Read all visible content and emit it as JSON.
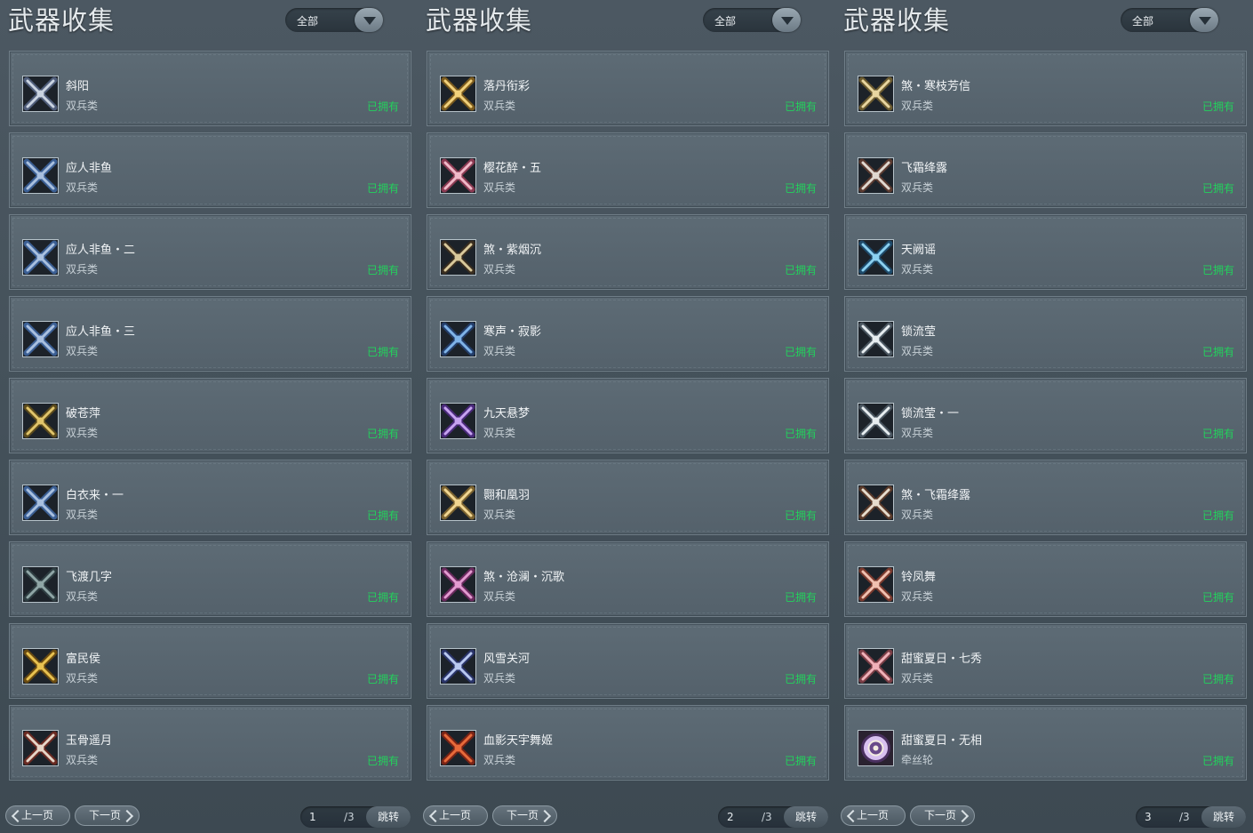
{
  "panels": [
    {
      "title": "武器收集",
      "filter_label": "全部",
      "prev_label": "上一页",
      "next_label": "下一页",
      "page_value": "1",
      "page_total": "/3",
      "jump_label": "跳转",
      "items": [
        {
          "name": "斜阳",
          "type": "双兵类",
          "status": "已拥有"
        },
        {
          "name": "应人非鱼",
          "type": "双兵类",
          "status": "已拥有"
        },
        {
          "name": "应人非鱼・二",
          "type": "双兵类",
          "status": "已拥有"
        },
        {
          "name": "应人非鱼・三",
          "type": "双兵类",
          "status": "已拥有"
        },
        {
          "name": "破苍萍",
          "type": "双兵类",
          "status": "已拥有"
        },
        {
          "name": "白衣来・一",
          "type": "双兵类",
          "status": "已拥有"
        },
        {
          "name": "飞渡几字",
          "type": "双兵类",
          "status": "已拥有"
        },
        {
          "name": "富民侯",
          "type": "双兵类",
          "status": "已拥有"
        },
        {
          "name": "玉骨遥月",
          "type": "双兵类",
          "status": "已拥有"
        }
      ]
    },
    {
      "title": "武器收集",
      "filter_label": "全部",
      "prev_label": "上一页",
      "next_label": "下一页",
      "page_value": "2",
      "page_total": "/3",
      "jump_label": "跳转",
      "items": [
        {
          "name": "落丹衔彩",
          "type": "双兵类",
          "status": "已拥有"
        },
        {
          "name": "樱花醉・五",
          "type": "双兵类",
          "status": "已拥有"
        },
        {
          "name": "煞・紫烟沉",
          "type": "双兵类",
          "status": "已拥有"
        },
        {
          "name": "寒声・寂影",
          "type": "双兵类",
          "status": "已拥有"
        },
        {
          "name": "九天悬梦",
          "type": "双兵类",
          "status": "已拥有"
        },
        {
          "name": "翾和凰羽",
          "type": "双兵类",
          "status": "已拥有"
        },
        {
          "name": "煞・沧澜・沉歌",
          "type": "双兵类",
          "status": "已拥有"
        },
        {
          "name": "风雪关河",
          "type": "双兵类",
          "status": "已拥有"
        },
        {
          "name": "血影天宇舞姬",
          "type": "双兵类",
          "status": "已拥有"
        }
      ]
    },
    {
      "title": "武器收集",
      "filter_label": "全部",
      "prev_label": "上一页",
      "next_label": "下一页",
      "page_value": "3",
      "page_total": "/3",
      "jump_label": "跳转",
      "items": [
        {
          "name": "煞・寒枝芳信",
          "type": "双兵类",
          "status": "已拥有"
        },
        {
          "name": "飞霜绛露",
          "type": "双兵类",
          "status": "已拥有"
        },
        {
          "name": "天阙谣",
          "type": "双兵类",
          "status": "已拥有"
        },
        {
          "name": "锁流莹",
          "type": "双兵类",
          "status": "已拥有"
        },
        {
          "name": "锁流莹・一",
          "type": "双兵类",
          "status": "已拥有"
        },
        {
          "name": "煞・飞霜绛露",
          "type": "双兵类",
          "status": "已拥有"
        },
        {
          "name": "铃凤舞",
          "type": "双兵类",
          "status": "已拥有"
        },
        {
          "name": "甜蜜夏日・七秀",
          "type": "双兵类",
          "status": "已拥有"
        },
        {
          "name": "甜蜜夏日・无相",
          "type": "牵丝轮",
          "status": "已拥有"
        }
      ]
    }
  ],
  "icon_palettes": [
    [
      "#c9d3e0",
      "#4f5d7a"
    ],
    [
      "#a9c0df",
      "#3b5f94"
    ],
    [
      "#a9c0df",
      "#3b5f94"
    ],
    [
      "#a9c0df",
      "#3b5f94"
    ],
    [
      "#e0c46a",
      "#5a4a1c"
    ],
    [
      "#a9c0df",
      "#3b5f94"
    ],
    [
      "#8fa6a6",
      "#2f3e42"
    ],
    [
      "#e8c250",
      "#6a4b12"
    ],
    [
      "#e6d6c8",
      "#6a2a22"
    ],
    [
      "#f1d07a",
      "#7a5a1e"
    ],
    [
      "#f0b8c8",
      "#8a3a52"
    ],
    [
      "#d8c89a",
      "#3a2e20"
    ],
    [
      "#7fb3e8",
      "#243e6a"
    ],
    [
      "#c6a2f0",
      "#4a2a7a"
    ],
    [
      "#f0d590",
      "#7a6230"
    ],
    [
      "#e39ad0",
      "#6a2a5e"
    ],
    [
      "#b8c8f0",
      "#2a3468"
    ],
    [
      "#e86a3a",
      "#7a2416"
    ],
    [
      "#e8d6a0",
      "#6a5a30"
    ],
    [
      "#e0d8d0",
      "#5a3a30"
    ],
    [
      "#8ad0f0",
      "#1e4a6a"
    ],
    [
      "#e6ecef",
      "#4a5660"
    ],
    [
      "#e6ecef",
      "#4a5660"
    ],
    [
      "#e6dccd",
      "#5a3a2a"
    ],
    [
      "#f0c0b0",
      "#7a3a2e"
    ],
    [
      "#f0b0b8",
      "#7a3e46"
    ],
    [
      "#d8c0f0",
      "#4a3060"
    ]
  ]
}
